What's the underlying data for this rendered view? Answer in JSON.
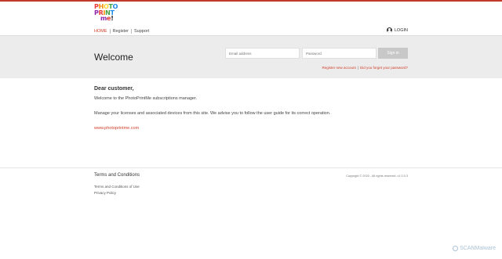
{
  "logo": {
    "line1": "PHOTO",
    "line2": "PRINT",
    "line3": "me!"
  },
  "nav": {
    "home": "HOME",
    "register": "Register",
    "support": "Support"
  },
  "login_label": "LOGIN",
  "band": {
    "title": "Welcome",
    "email_placeholder": "Email address",
    "password_placeholder": "Password",
    "signin_label": "Sign in",
    "register_link": "Register new account",
    "forgot_link": "Did you forget your password?"
  },
  "main": {
    "greeting": "Dear customer,",
    "intro": "Welcome to the PhotoPrintMe subscriptions manager.",
    "manage": "Manage your licenses and associated devices from this site. We advise you to follow the user guide for its correct operation.",
    "site_link": "www.photoprintme.com"
  },
  "footer": {
    "title": "Terms and Conditions",
    "copyright": "Copyright © 2020 - All rights reserved. v1.0.0.3",
    "link1": "Terms and Conditions of Use",
    "link2": "Privacy Policy"
  },
  "watermark": "SCANMalware",
  "colors": {
    "accent": "#d0402b",
    "band": "#ececec",
    "signin": "#c8c8c8"
  }
}
